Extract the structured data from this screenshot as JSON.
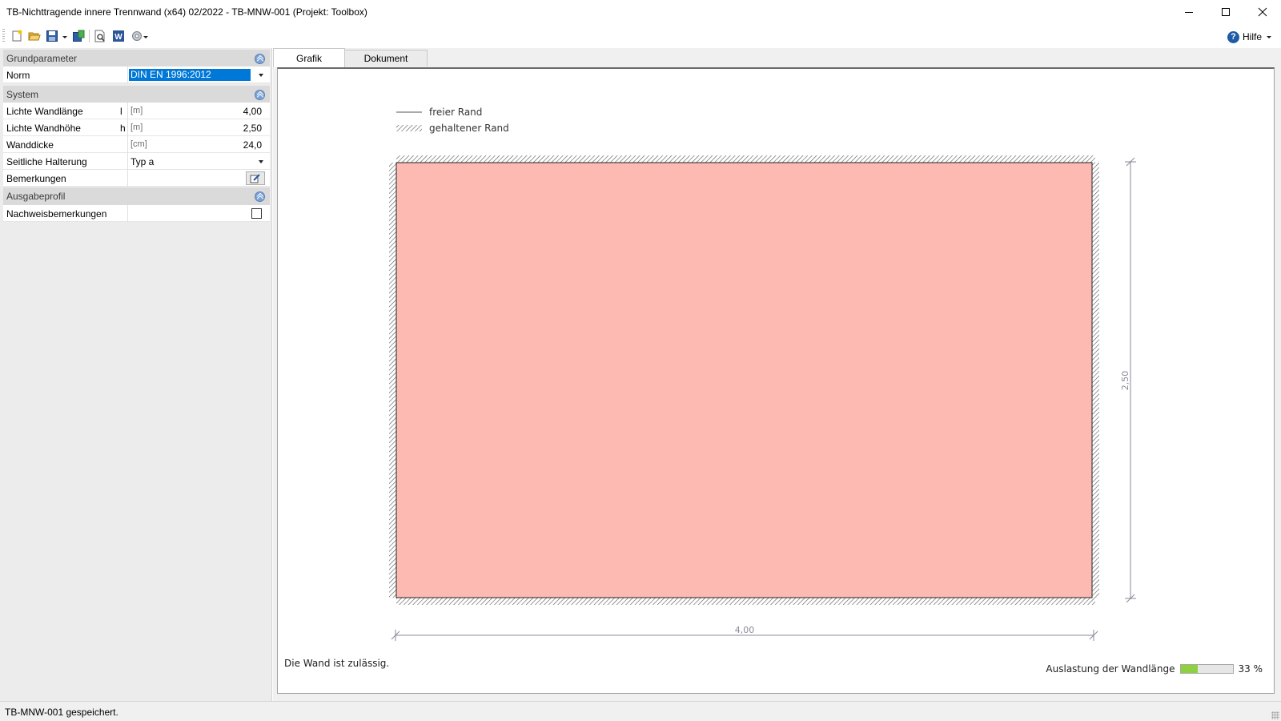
{
  "window": {
    "title": "TB-Nichttragende innere Trennwand (x64) 02/2022 - TB-MNW-001 (Projekt: Toolbox)"
  },
  "toolbar": {
    "help_label": "Hilfe",
    "icons": [
      "new-file-icon",
      "open-folder-icon",
      "save-icon",
      "export-icon",
      "print-preview-icon",
      "word-icon",
      "settings-icon"
    ]
  },
  "left_panel": {
    "groups": {
      "grundparameter": "Grundparameter",
      "system": "System",
      "ausgabeprofil": "Ausgabeprofil"
    },
    "norm": {
      "label": "Norm",
      "value": "DIN EN 1996:2012"
    },
    "wandlaenge": {
      "label": "Lichte Wandlänge",
      "symbol": "l",
      "unit": "[m]",
      "value": "4,00"
    },
    "wandhoehe": {
      "label": "Lichte Wandhöhe",
      "symbol": "h",
      "unit": "[m]",
      "value": "2,50"
    },
    "wanddicke": {
      "label": "Wanddicke",
      "unit": "[cm]",
      "value": "24,0"
    },
    "halterung": {
      "label": "Seitliche Halterung",
      "value": "Typ a"
    },
    "bemerkungen": {
      "label": "Bemerkungen",
      "value": ""
    },
    "nachweis": {
      "label": "Nachweisbemerkungen",
      "checked": false
    }
  },
  "tabs": [
    {
      "label": "Grafik",
      "active": true
    },
    {
      "label": "Dokument",
      "active": false
    }
  ],
  "graphic": {
    "legend_free": "freier Rand",
    "legend_held": "gehaltener Rand",
    "dim_length": "4,00",
    "dim_height": "2,50",
    "wall_color": "#fcbab2",
    "status_message": "Die Wand ist zulässig.",
    "usage_label": "Auslastung der Wandlänge",
    "usage_percent": "33 %",
    "usage_fraction": 0.33
  },
  "statusbar": {
    "text": "TB-MNW-001 gespeichert."
  }
}
